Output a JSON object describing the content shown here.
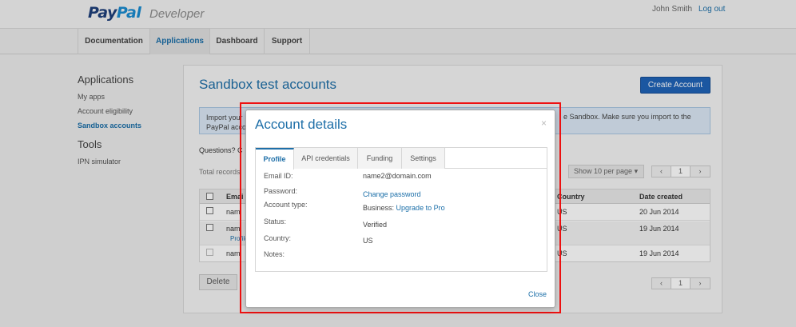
{
  "header": {
    "logo_pay": "Pay",
    "logo_pal": "Pal",
    "logo_sub": "Developer",
    "user_name": "John Smith",
    "logout": "Log out"
  },
  "nav": {
    "tabs": [
      {
        "label": "Documentation",
        "active": false
      },
      {
        "label": "Applications",
        "active": true
      },
      {
        "label": "Dashboard",
        "active": false
      },
      {
        "label": "Support",
        "active": false
      }
    ]
  },
  "sidebar": {
    "heading_apps": "Applications",
    "items": [
      {
        "label": "My apps",
        "active": false
      },
      {
        "label": "Account eligibility",
        "active": false
      },
      {
        "label": "Sandbox accounts",
        "active": true
      }
    ],
    "heading_tools": "Tools",
    "tools": [
      {
        "label": "IPN simulator"
      }
    ]
  },
  "main": {
    "title": "Sandbox test accounts",
    "create_button": "Create Account",
    "info_line1_left": "Import your",
    "info_line1_right": "e Sandbox. Make sure you import to the",
    "info_line2": "PayPal acco",
    "questions": "Questions? C",
    "total_records": "Total records",
    "per_page": "Show 10 per page",
    "pager": {
      "prev": "‹",
      "page": "1",
      "next": "›"
    },
    "table": {
      "headers": {
        "email": "Emai",
        "country": "Country",
        "date": "Date created"
      },
      "rows": [
        {
          "email": "nam",
          "country": "US",
          "date": "20 Jun 2014"
        },
        {
          "email": "nam",
          "sub": "Profile",
          "country": "US",
          "date": "19 Jun 2014"
        },
        {
          "email": "nam",
          "country": "US",
          "date": "19 Jun 2014"
        }
      ]
    },
    "delete_button": "Delete"
  },
  "modal": {
    "title": "Account details",
    "close_x": "×",
    "tabs": [
      {
        "label": "Profile",
        "active": true
      },
      {
        "label": "API credentials",
        "active": false
      },
      {
        "label": "Funding",
        "active": false
      },
      {
        "label": "Settings",
        "active": false
      }
    ],
    "fields": {
      "email_label": "Email ID:",
      "email_value": "name2@domain.com",
      "password_label": "Password:",
      "password_link": "Change password",
      "type_label": "Account type:",
      "type_value": "Business",
      "type_link": "Upgrade to Pro",
      "status_label": "Status:",
      "status_value": "Verified",
      "country_label": "Country:",
      "country_value": "US",
      "notes_label": "Notes:"
    },
    "close_link": "Close"
  },
  "colors": {
    "brand_blue": "#1e6fa8",
    "button_blue": "#1f63b8",
    "highlight_red": "#ee1111"
  }
}
